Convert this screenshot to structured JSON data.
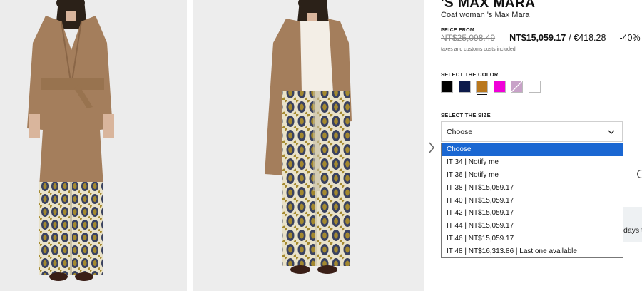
{
  "product": {
    "brand": "'S MAX MARA",
    "subtitle": "Coat woman 's Max Mara"
  },
  "price": {
    "from_label": "PRICE FROM",
    "old": "NT$25,098.49",
    "current": "NT$15,059.17",
    "eur": "/ €418.28",
    "discount": "-40%",
    "taxes_note": "taxes and customs costs included"
  },
  "colors": {
    "label": "SELECT THE COLOR",
    "selected_index": 2,
    "swatches": [
      {
        "name": "black-swatch",
        "color": "#000000"
      },
      {
        "name": "navy-swatch",
        "color": "#0d1b4b"
      },
      {
        "name": "camel-swatch",
        "color": "#b9771c"
      },
      {
        "name": "magenta-swatch",
        "color": "#f000d8"
      },
      {
        "name": "lilac-swatch",
        "color": "#c8a2c8"
      },
      {
        "name": "white-swatch",
        "color": "#ffffff"
      }
    ]
  },
  "size": {
    "label": "SELECT THE SIZE",
    "selected_value": "Choose",
    "options": [
      "Choose",
      "IT 34 | Notify me",
      "IT 36 | Notify me",
      "IT 38 | NT$15,059.17",
      "IT 40 | NT$15,059.17",
      "IT 42 | NT$15,059.17",
      "IT 44 | NT$15,059.17",
      "IT 46 | NT$15,059.17",
      "IT 48 | NT$16,313.86 | Last one available"
    ],
    "highlighted_index": 0
  },
  "side_panel": {
    "text": "days to"
  },
  "icons": {
    "gallery_next": "chevron-right-icon",
    "select_chevron": "chevron-down-icon"
  },
  "theme": {
    "highlight": "#1a67d2",
    "coat": "#a47e5c",
    "pattern_gold": "#a4892f",
    "pattern_navy": "#3a4260"
  }
}
